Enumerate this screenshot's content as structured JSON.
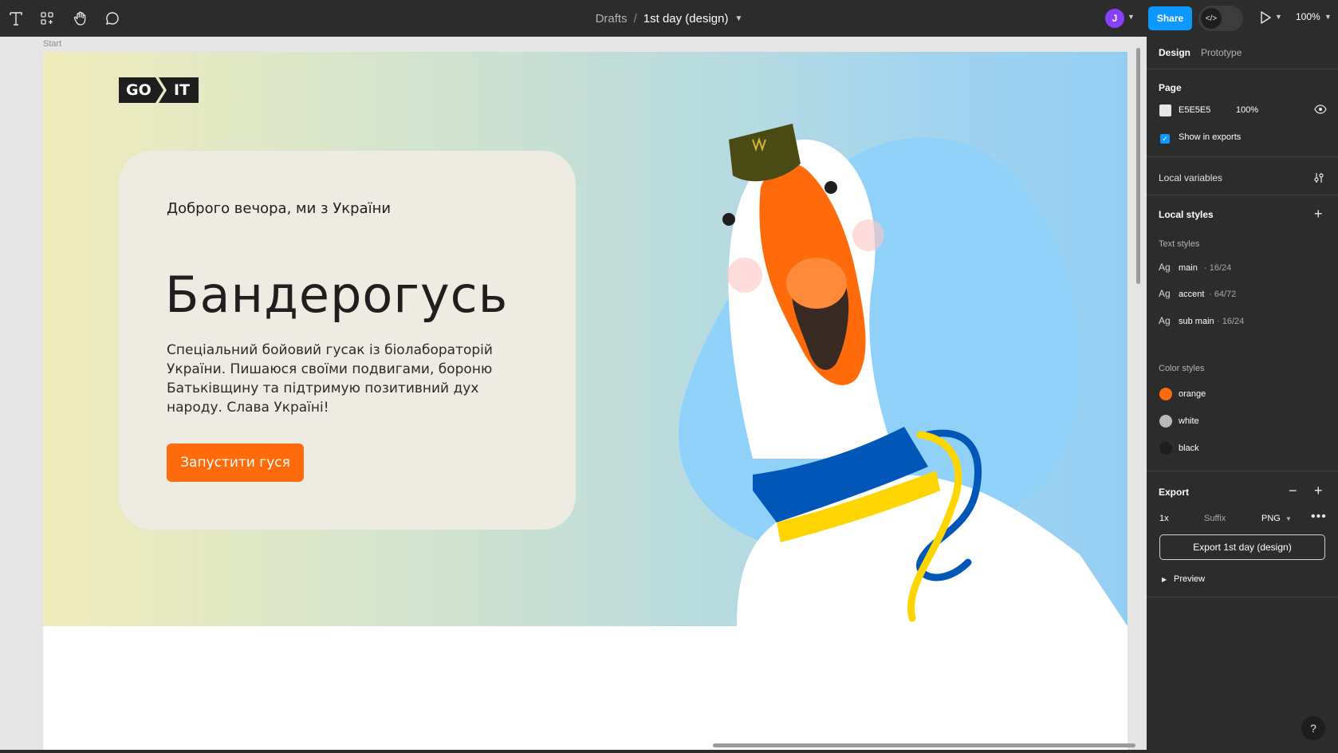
{
  "toolbar": {
    "tools": [
      "text-tool",
      "components-tool",
      "hand-tool",
      "comment-tool"
    ],
    "breadcrumb": {
      "drafts": "Drafts",
      "separator": "/",
      "file": "1st day (design)"
    },
    "avatar_initial": "J",
    "share_label": "Share",
    "zoom": "100%"
  },
  "canvas": {
    "frame_label": "Start",
    "hero": {
      "logo_left": "GO",
      "logo_right": "IT",
      "greeting": "Доброго вечора, ми з України",
      "title": "Бандерогусь",
      "description": "Спеціальний бойовий гусак із біолабораторій України. Пишаюся своїми подвигами, бороню Батьківщину та підтримую позитивний дух народу. Слава Україні!",
      "cta": "Запустити гуся"
    }
  },
  "panel": {
    "tabs": {
      "design": "Design",
      "prototype": "Prototype"
    },
    "page": {
      "title": "Page",
      "color_hex": "E5E5E5",
      "opacity": "100%",
      "show_in_exports": "Show in exports"
    },
    "local_variables": "Local variables",
    "local_styles": "Local styles",
    "text_styles_title": "Text styles",
    "text_styles": [
      {
        "ag": "Ag",
        "name": "main",
        "spec": " · 16/24"
      },
      {
        "ag": "Ag",
        "name": "accent",
        "spec": " · 64/72"
      },
      {
        "ag": "Ag",
        "name": "sub main",
        "spec": " · 16/24"
      }
    ],
    "color_styles_title": "Color styles",
    "color_styles": [
      {
        "name": "orange",
        "color": "#ff6b0a"
      },
      {
        "name": "white",
        "color": "#b8b8b8"
      },
      {
        "name": "black",
        "color": "#1e1e1e"
      }
    ],
    "export": {
      "title": "Export",
      "scale": "1x",
      "suffix_placeholder": "Suffix",
      "format": "PNG",
      "button": "Export 1st day (design)",
      "preview": "Preview"
    },
    "help": "?"
  },
  "colors": {
    "accent": "#0d99ff",
    "brand_orange": "#ff6b0a",
    "page_bg": "#E5E5E5"
  }
}
